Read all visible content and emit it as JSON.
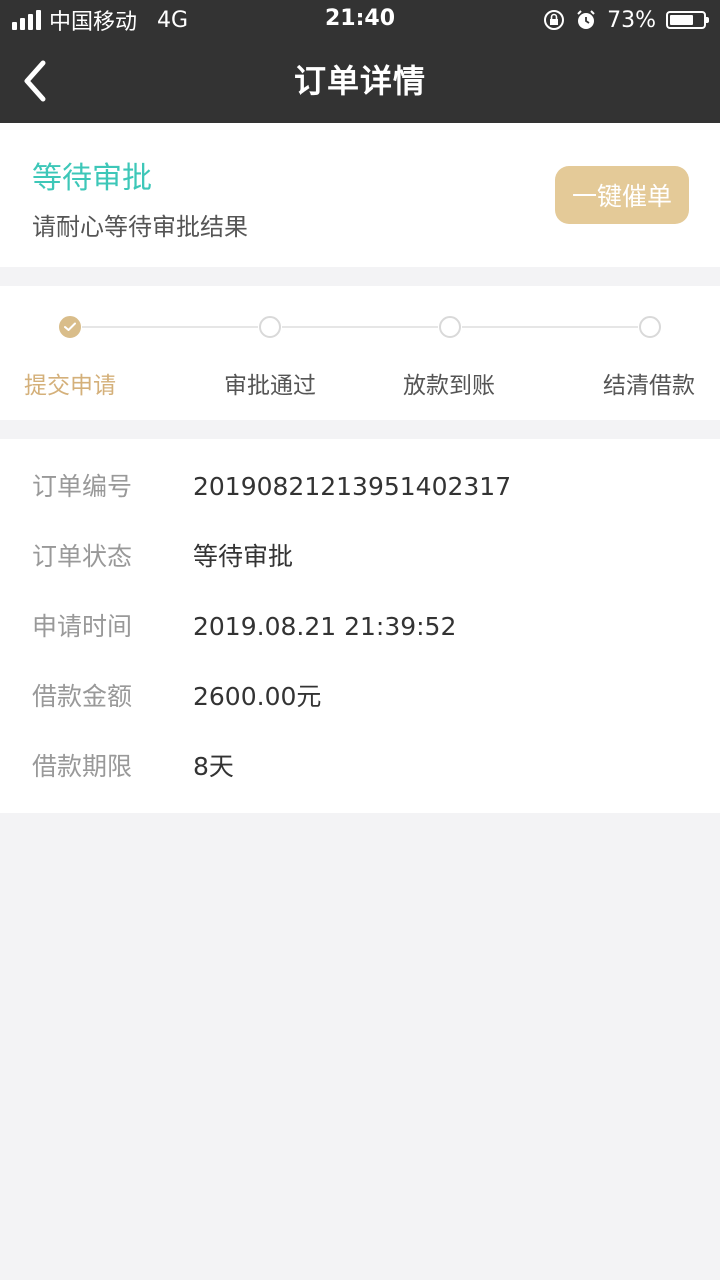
{
  "status_bar": {
    "carrier": "中国移动",
    "network": "4G",
    "time": "21:40",
    "battery_text": "73%",
    "battery_level": 0.73
  },
  "nav": {
    "title": "订单详情",
    "back_icon": "chevron-left-icon"
  },
  "status_card": {
    "title": "等待审批",
    "description": "请耐心等待审批结果",
    "urge_button": "一键催单",
    "title_color": "#3dc7b8",
    "button_color": "#e4ca98"
  },
  "progress": {
    "current_step": 0,
    "active_color": "#d9bd8a",
    "steps": [
      {
        "label": "提交申请",
        "done": true
      },
      {
        "label": "审批通过",
        "done": false
      },
      {
        "label": "放款到账",
        "done": false
      },
      {
        "label": "结清借款",
        "done": false
      }
    ]
  },
  "order_info": {
    "rows": [
      {
        "label": "订单编号",
        "value": "20190821213951402317"
      },
      {
        "label": "订单状态",
        "value": "等待审批"
      },
      {
        "label": "申请时间",
        "value": "2019.08.21 21:39:52"
      },
      {
        "label": "借款金额",
        "value": "2600.00元"
      },
      {
        "label": "借款期限",
        "value": "8天"
      }
    ]
  }
}
